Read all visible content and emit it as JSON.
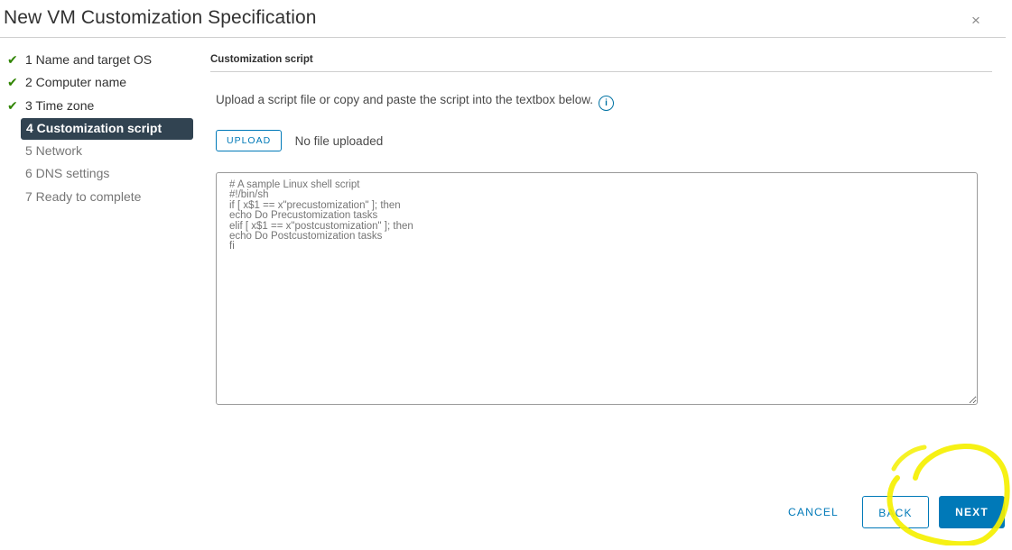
{
  "dialog": {
    "title": "New VM Customization Specification",
    "close_icon": "close-icon",
    "close_glyph": "×"
  },
  "steps": [
    {
      "label": "1 Name and target OS",
      "status": "done",
      "check": "✔"
    },
    {
      "label": "2 Computer name",
      "status": "done",
      "check": "✔"
    },
    {
      "label": "3 Time zone",
      "status": "done",
      "check": "✔"
    },
    {
      "label": "4 Customization script",
      "status": "active"
    },
    {
      "label": "5 Network",
      "status": "pending"
    },
    {
      "label": "6 DNS settings",
      "status": "pending"
    },
    {
      "label": "7 Ready to complete",
      "status": "pending"
    }
  ],
  "content": {
    "section_title": "Customization script",
    "description": "Upload a script file or copy and paste the script into the textbox below.",
    "info_icon": "info-icon",
    "info_glyph": "i",
    "upload_label": "UPLOAD",
    "upload_status": "No file uploaded",
    "script_placeholder": "# A sample Linux shell script\n#!/bin/sh\nif [ x$1 == x\"precustomization\" ]; then\necho Do Precustomization tasks\nelif [ x$1 == x\"postcustomization\" ]; then\necho Do Postcustomization tasks\nfi"
  },
  "footer": {
    "cancel_label": "CANCEL",
    "back_label": "BACK",
    "next_label": "NEXT"
  },
  "colors": {
    "accent": "#0079b8",
    "active_step_bg": "#314351",
    "check_green": "#2f8400",
    "highlight_yellow": "#f5f000"
  }
}
